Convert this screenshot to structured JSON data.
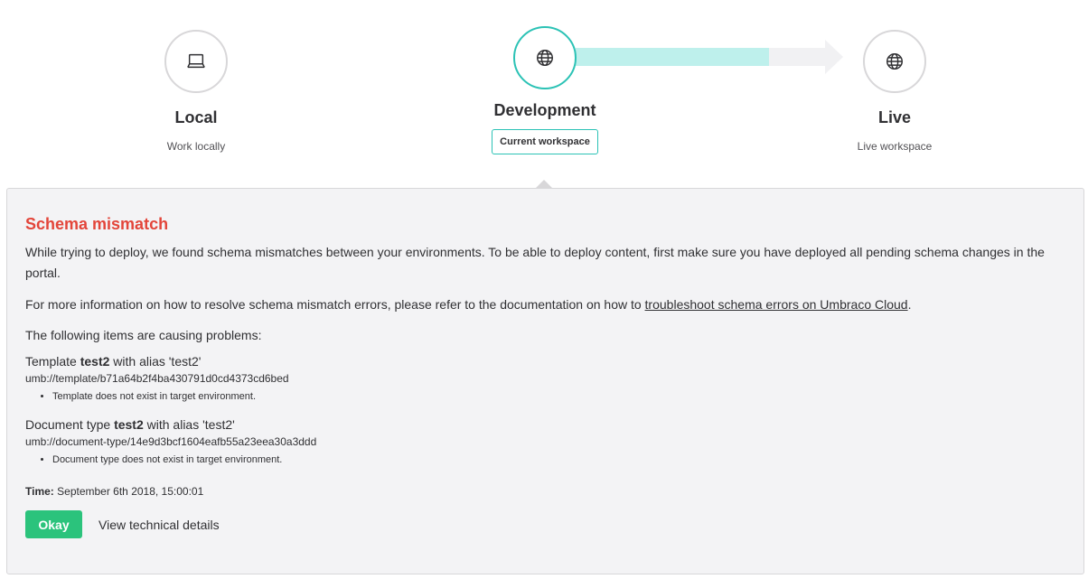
{
  "workflow": {
    "local": {
      "name": "Local",
      "subtitle": "Work locally",
      "icon": "laptop-icon"
    },
    "development": {
      "name": "Development",
      "badge": "Current workspace",
      "icon": "globe-icon"
    },
    "live": {
      "name": "Live",
      "subtitle": "Live workspace",
      "icon": "globe-icon"
    },
    "progress_fraction": 0.77,
    "colors": {
      "accent": "#2bc2b5",
      "progress": "#bef0ec",
      "track": "#f1f1f3"
    }
  },
  "panel": {
    "title": "Schema mismatch",
    "paragraph1": "While trying to deploy, we found schema mismatches between your environments. To be able to deploy content, first make sure you have deployed all pending schema changes in the portal.",
    "paragraph2_prefix": "For more information on how to resolve schema mismatch errors, please refer to the documentation on how to ",
    "paragraph2_link": "troubleshoot schema errors on Umbraco Cloud",
    "paragraph2_suffix": ".",
    "issues_intro": "The following items are causing problems:",
    "issues": [
      {
        "type": "Template",
        "name": "test2",
        "alias_text": "with alias 'test2'",
        "udi": "umb://template/b71a64b2f4ba430791d0cd4373cd6bed",
        "reason": "Template does not exist in target environment."
      },
      {
        "type": "Document type",
        "name": "test2",
        "alias_text": "with alias 'test2'",
        "udi": "umb://document-type/14e9d3bcf1604eafb55a23eea30a3ddd",
        "reason": "Document type does not exist in target environment."
      }
    ],
    "time_label": "Time:",
    "time_value": "September 6th 2018, 15:00:01",
    "ok_button": "Okay",
    "tech_details_link": "View technical details",
    "colors": {
      "title": "#e3453a",
      "ok_button": "#2bc37c"
    }
  }
}
